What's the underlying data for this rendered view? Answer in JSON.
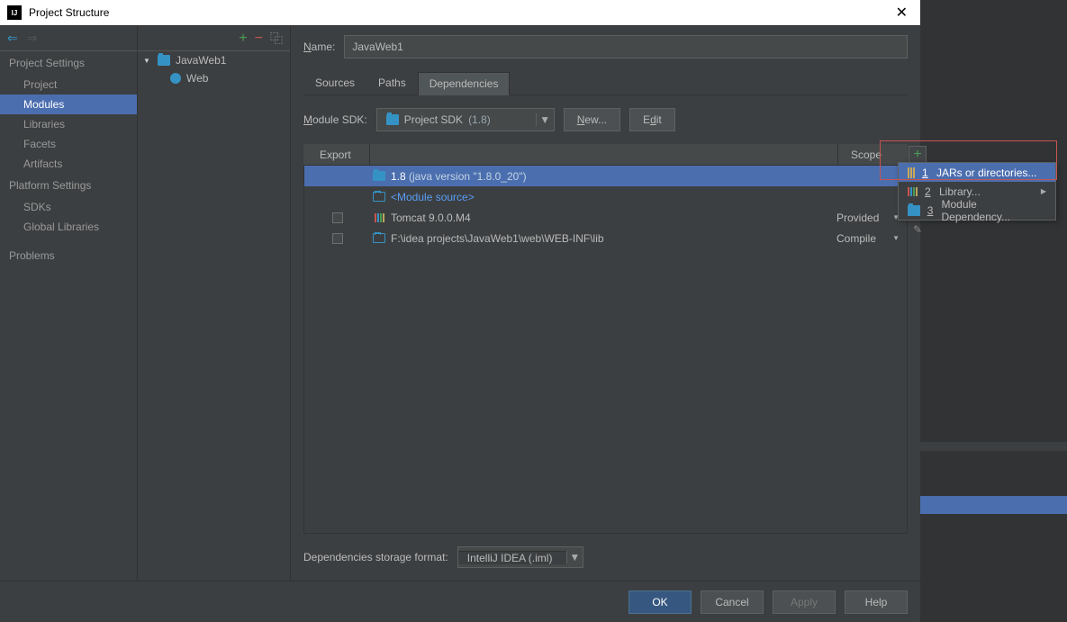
{
  "titlebar": {
    "title": "Project Structure",
    "close": "✕"
  },
  "nav": {
    "back_icon": "⇐",
    "fwd_icon": "⇒",
    "section1": "Project Settings",
    "items1": [
      "Project",
      "Modules",
      "Libraries",
      "Facets",
      "Artifacts"
    ],
    "section2": "Platform Settings",
    "items2": [
      "SDKs",
      "Global Libraries"
    ],
    "problems": "Problems"
  },
  "tree": {
    "toolbar": {
      "plus": "+",
      "minus": "−",
      "copy": "⿻"
    },
    "root": "JavaWeb1",
    "child": "Web"
  },
  "main": {
    "name_label": "Name:",
    "name_value": "JavaWeb1",
    "tabs": [
      "Sources",
      "Paths",
      "Dependencies"
    ],
    "sdk_label": "Module SDK:",
    "sdk_value": "Project SDK",
    "sdk_ver": "(1.8)",
    "new_btn": "New...",
    "edit_btn": "Edit",
    "th_export": "Export",
    "th_scope": "Scope",
    "rows": [
      {
        "text_a": "1.8 ",
        "text_b": "(java version \"1.8.0_20\")",
        "selected": true,
        "type": "folder"
      },
      {
        "text_a": "<Module source>",
        "selected": false,
        "type": "source"
      },
      {
        "text_a": "Tomcat 9.0.0.M4",
        "scope": "Provided",
        "chk": true,
        "type": "lib"
      },
      {
        "text_a": "F:\\idea projects\\JavaWeb1\\web\\WEB-INF\\lib",
        "scope": "Compile",
        "chk": true,
        "type": "folder-o"
      }
    ],
    "side": {
      "plus": "+",
      "minus": "−",
      "up": "↑",
      "down": "↓",
      "pen": "✎"
    },
    "storage_label": "Dependencies storage format:",
    "storage_value": "IntelliJ IDEA (.iml)"
  },
  "footer": {
    "ok": "OK",
    "cancel": "Cancel",
    "apply": "Apply",
    "help": "Help"
  },
  "popup": {
    "items": [
      {
        "num": "1",
        "label": "JARs or directories...",
        "type": "jar"
      },
      {
        "num": "2",
        "label": "Library...",
        "type": "lib",
        "sub": "▶"
      },
      {
        "num": "3",
        "label": "Module Dependency...",
        "type": "mod"
      }
    ]
  }
}
